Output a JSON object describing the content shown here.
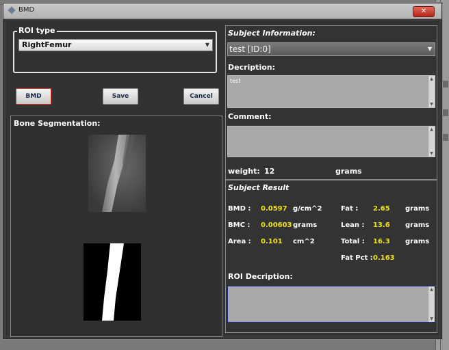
{
  "window": {
    "title": "BMD",
    "close_icon": "close-icon"
  },
  "roi": {
    "group_label": "ROI type",
    "selected": "RightFemur"
  },
  "buttons": {
    "bmd": "BMD",
    "save": "Save",
    "cancel": "Cancel"
  },
  "segmentation": {
    "title": "Bone Segmentation:"
  },
  "subject_info": {
    "title": "Subject Information:",
    "selected_subject": "test [ID:0]",
    "description_label": "Decription:",
    "description_value": "test",
    "comment_label": "Comment:",
    "comment_value": "",
    "weight_label": "weight:",
    "weight_value": "12",
    "weight_unit": "grams"
  },
  "subject_result": {
    "title": "Subject Result",
    "bmd_label": "BMD :",
    "bmd_value": "0.0597",
    "bmd_unit": "g/cm^2",
    "bmc_label": "BMC :",
    "bmc_value": "0.00603",
    "bmc_unit": "grams",
    "area_label": "Area :",
    "area_value": "0.101",
    "area_unit": "cm^2",
    "fat_label": "Fat :",
    "fat_value": "2.65",
    "fat_unit": "grams",
    "lean_label": "Lean :",
    "lean_value": "13.6",
    "lean_unit": "grams",
    "total_label": "Total :",
    "total_value": "16.3",
    "total_unit": "grams",
    "fatpct_label": "Fat Pct :",
    "fatpct_value": "0.163",
    "roi_desc_label": "ROI Decription:"
  },
  "colors": {
    "value_yellow": "#f2e21c",
    "close_red": "#c0392b"
  }
}
